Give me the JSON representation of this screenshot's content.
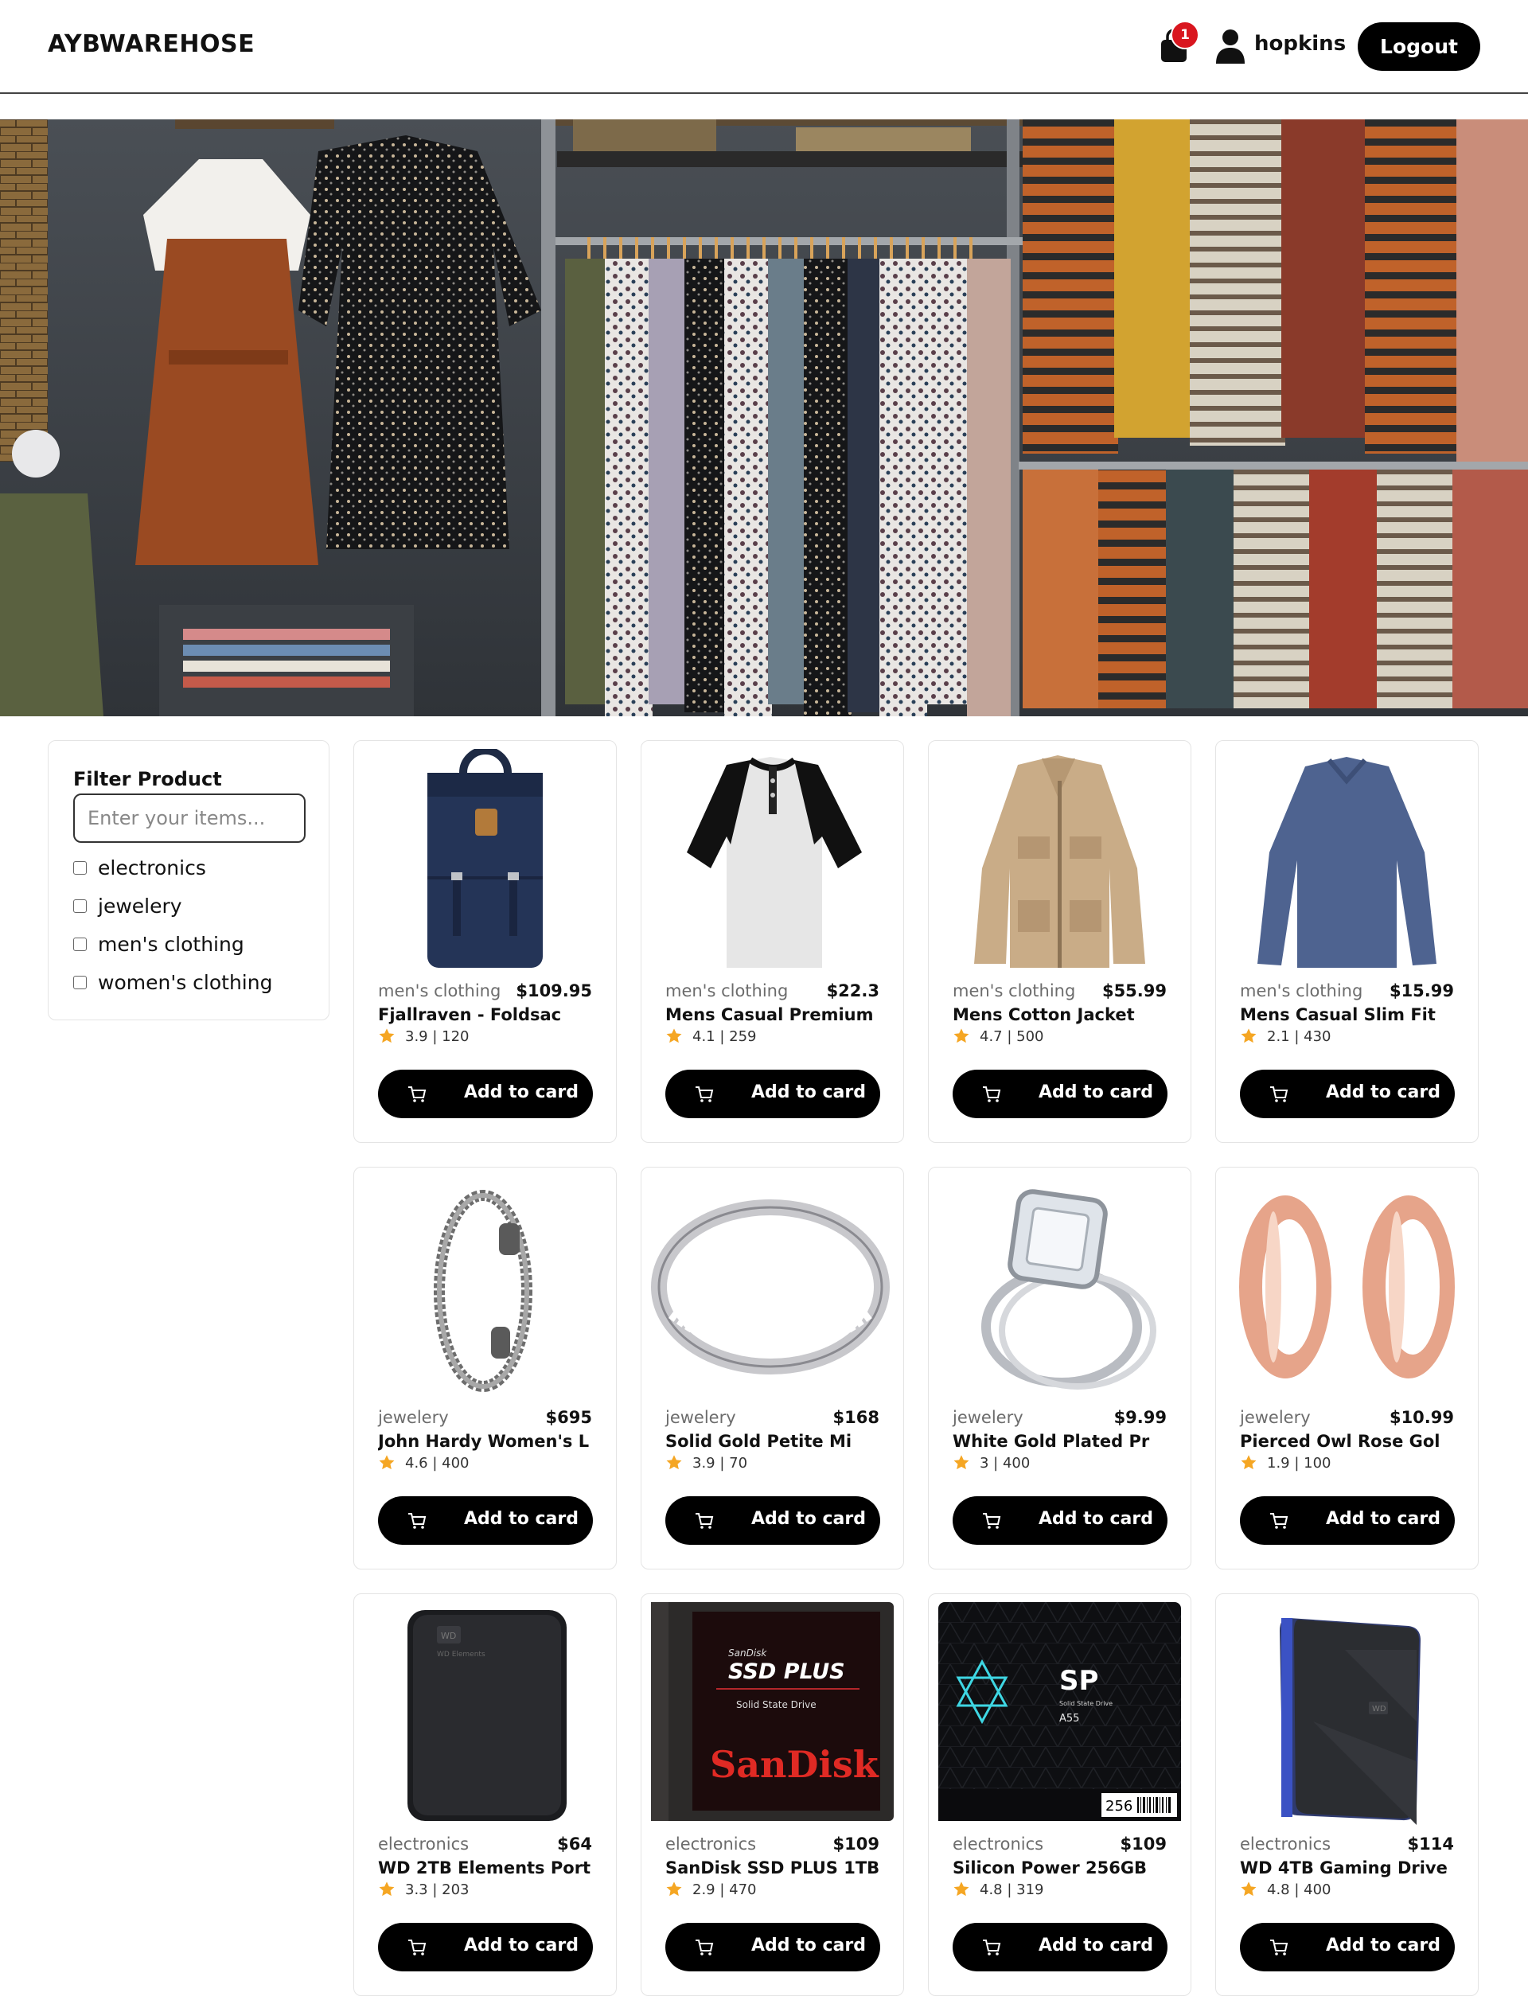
{
  "header": {
    "brand": "AYBWAREHOSE",
    "cart_count": "1",
    "username": "hopkins",
    "logout_label": "Logout"
  },
  "hero": {
    "icon": "clothing-rack-photo"
  },
  "filter": {
    "title": "Filter Product",
    "placeholder": "Enter your items...",
    "options": [
      "electronics",
      "jewelery",
      "men's clothing",
      "women's clothing"
    ]
  },
  "products": [
    {
      "category": "men's clothing",
      "price": "$109.95",
      "title": "Fjallraven - Foldsac",
      "rating": "3.9 | 120",
      "button": "Add to card",
      "icon": "backpack-image"
    },
    {
      "category": "men's clothing",
      "price": "$22.3",
      "title": "Mens Casual Premium",
      "rating": "4.1 | 259",
      "button": "Add to card",
      "icon": "raglan-tshirt-image"
    },
    {
      "category": "men's clothing",
      "price": "$55.99",
      "title": "Mens Cotton Jacket",
      "rating": "4.7 | 500",
      "button": "Add to card",
      "icon": "jacket-image"
    },
    {
      "category": "men's clothing",
      "price": "$15.99",
      "title": "Mens Casual Slim Fit",
      "rating": "2.1 | 430",
      "button": "Add to card",
      "icon": "longsleeve-shirt-image"
    },
    {
      "category": "jewelery",
      "price": "$695",
      "title": "John Hardy Women's L",
      "rating": "4.6 | 400",
      "button": "Add to card",
      "icon": "bracelet-image"
    },
    {
      "category": "jewelery",
      "price": "$168",
      "title": "Solid Gold Petite Mi",
      "rating": "3.9 | 70",
      "button": "Add to card",
      "icon": "ring-image"
    },
    {
      "category": "jewelery",
      "price": "$9.99",
      "title": "White Gold Plated Pr",
      "rating": "3 | 400",
      "button": "Add to card",
      "icon": "diamond-ring-image"
    },
    {
      "category": "jewelery",
      "price": "$10.99",
      "title": "Pierced Owl Rose Gol",
      "rating": "1.9 | 100",
      "button": "Add to card",
      "icon": "tunnel-plugs-image"
    },
    {
      "category": "electronics",
      "price": "$64",
      "title": "WD 2TB Elements Port",
      "rating": "3.3 | 203",
      "button": "Add to card",
      "icon": "hard-drive-image"
    },
    {
      "category": "electronics",
      "price": "$109",
      "title": "SanDisk SSD PLUS 1TB",
      "rating": "2.9 | 470",
      "button": "Add to card",
      "icon": "sandisk-ssd-image"
    },
    {
      "category": "electronics",
      "price": "$109",
      "title": "Silicon Power 256GB",
      "rating": "4.8 | 319",
      "button": "Add to card",
      "icon": "silicon-power-ssd-image"
    },
    {
      "category": "electronics",
      "price": "$114",
      "title": "WD 4TB Gaming Drive",
      "rating": "4.8 | 400",
      "button": "Add to card",
      "icon": "gaming-drive-image"
    }
  ],
  "image_text": {
    "sandisk_small": "SanDisk",
    "sandisk_line": "SSD PLUS",
    "sandisk_sub": "Solid State Drive",
    "sandisk_brand": "SanDisk",
    "sp_logo": "SP",
    "sp_sub": "Solid State Drive",
    "sp_model": "A55",
    "sp_capacity": "256",
    "wd_badge": "WD",
    "wd_elements": "WD Elements"
  },
  "colors": {
    "badge": "#d9161f",
    "star": "#f5a623",
    "button": "#000000"
  }
}
